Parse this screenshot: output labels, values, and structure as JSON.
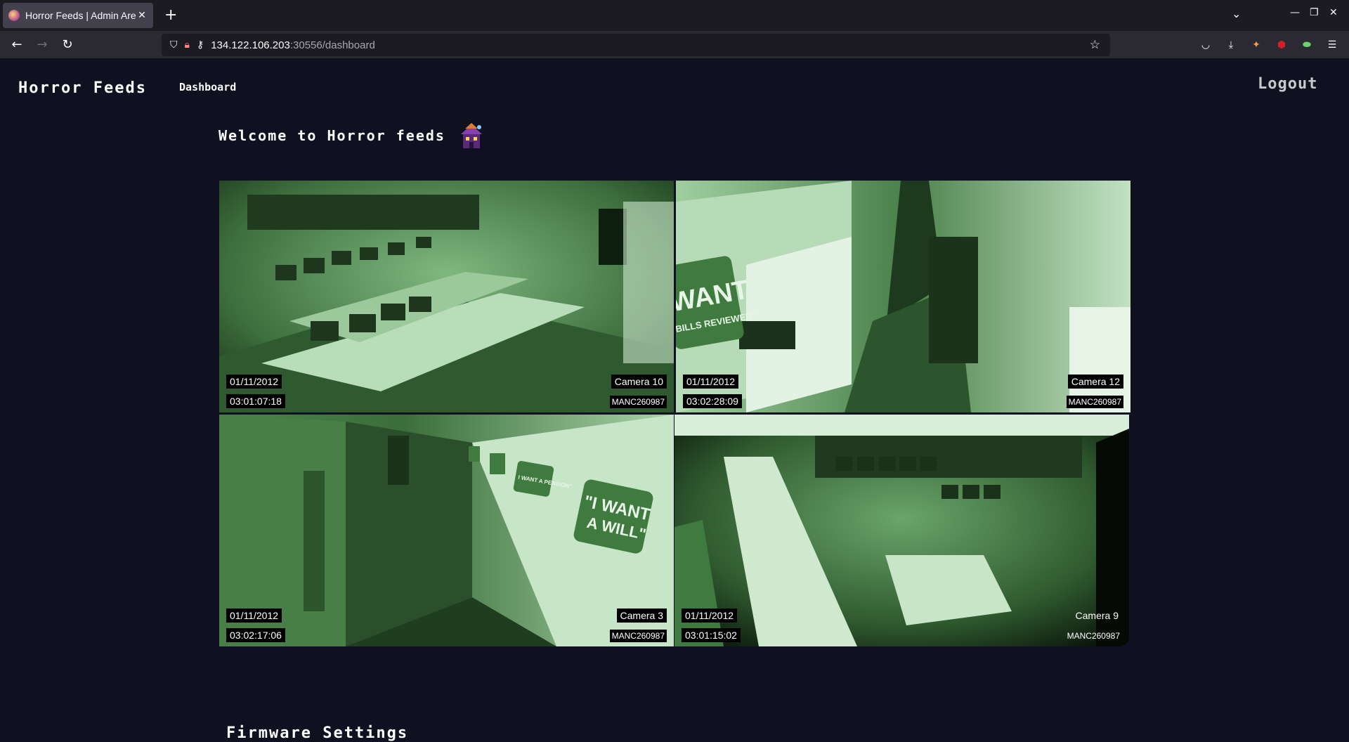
{
  "browser": {
    "tab_title": "Horror Feeds | Admin Area",
    "url_host": "134.122.106.203",
    "url_rest": ":30556/dashboard"
  },
  "header": {
    "brand": "Horror Feeds",
    "nav_dashboard": "Dashboard",
    "logout": "Logout"
  },
  "main": {
    "welcome": "Welcome to Horror feeds",
    "section_title": "Firmware Settings"
  },
  "cameras": [
    {
      "date": "01/11/2012",
      "time": "03:01:07:18",
      "name": "Camera 10",
      "id": "MANC260987"
    },
    {
      "date": "01/11/2012",
      "time": "03:02:28:09",
      "name": "Camera 12",
      "id": "MANC260987"
    },
    {
      "date": "01/11/2012",
      "time": "03:02:17:06",
      "name": "Camera 3",
      "id": "MANC260987"
    },
    {
      "date": "01/11/2012",
      "time": "03:01:15:02",
      "name": "Camera 9",
      "id": "MANC260987"
    }
  ],
  "camera_signs": {
    "cam12_sign_line1": "WANT",
    "cam12_sign_line2": "BILLS REVIEWED\"",
    "cam3_sign_line1": "\"I WANT",
    "cam3_sign_line2": "A WILL\"",
    "cam3_small_sign": "I WANT A PENSION\""
  },
  "colors": {
    "page_bg": "#0f1020",
    "feed_green": "#3f7a3f",
    "feed_highlight": "#cdeccd"
  },
  "icons": [
    "back-icon",
    "forward-icon",
    "reload-icon",
    "shield-icon",
    "lock-icon",
    "key-icon",
    "star-icon",
    "pocket-icon",
    "download-icon",
    "extension-icon",
    "ublock-icon",
    "toggle-icon",
    "menu-icon",
    "house-emoji-icon"
  ]
}
